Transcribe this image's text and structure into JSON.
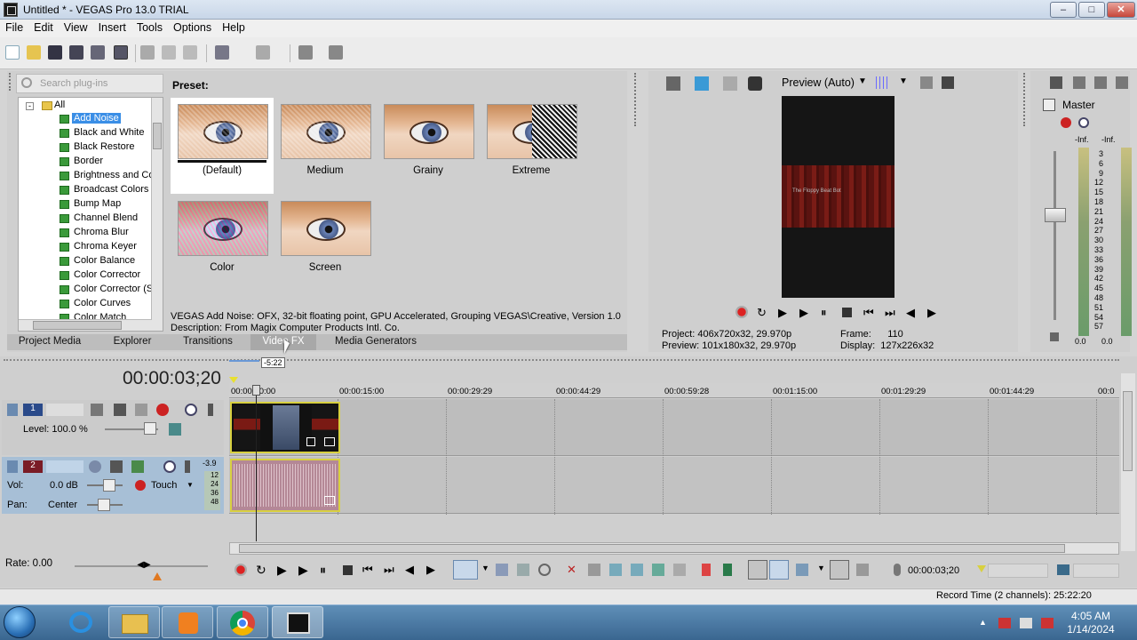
{
  "window": {
    "title": "Untitled * - VEGAS Pro 13.0 TRIAL",
    "min": "–",
    "max": "□",
    "close": "✕"
  },
  "menu": [
    "File",
    "Edit",
    "View",
    "Insert",
    "Tools",
    "Options",
    "Help"
  ],
  "plugins": {
    "search_placeholder": "Search plug-ins",
    "root": "All",
    "items": [
      "Add Noise",
      "Black and White",
      "Black Restore",
      "Border",
      "Brightness and Co",
      "Broadcast Colors",
      "Bump Map",
      "Channel Blend",
      "Chroma Blur",
      "Chroma Keyer",
      "Color Balance",
      "Color Corrector",
      "Color Corrector (S",
      "Color Curves",
      "Color Match"
    ],
    "selected": "Add Noise"
  },
  "presets": {
    "label": "Preset:",
    "items": [
      "(Default)",
      "Medium",
      "Grainy",
      "Extreme",
      "Color",
      "Screen"
    ],
    "description_line1": "VEGAS Add Noise: OFX, 32-bit floating point, GPU Accelerated, Grouping VEGAS\\Creative, Version 1.0",
    "description_line2": "Description: From Magix Computer Products Intl. Co."
  },
  "tabs": [
    "Project Media",
    "Explorer",
    "Transitions",
    "Video FX",
    "Media Generators"
  ],
  "active_tab": "Video FX",
  "preview": {
    "mode": "Preview (Auto)",
    "video_text": "The Floppy Beat Bot",
    "project_label": "Project:",
    "project_value": "406x720x32, 29.970p",
    "preview_label": "Preview:",
    "preview_value": "101x180x32, 29.970p",
    "frame_label": "Frame:",
    "frame_value": "110",
    "display_label": "Display:",
    "display_value": "127x226x32"
  },
  "master": {
    "label": "Master",
    "inf_left": "-Inf.",
    "inf_right": "-Inf.",
    "ticks": [
      "3",
      "6",
      "9",
      "12",
      "15",
      "18",
      "21",
      "24",
      "27",
      "30",
      "33",
      "36",
      "39",
      "42",
      "45",
      "48",
      "51",
      "54",
      "57"
    ],
    "bottom_left": "0.0",
    "bottom_right": "0.0"
  },
  "timeline": {
    "time_code": "00:00:03;20",
    "loop_marker": "-5:22",
    "ruler": [
      "00:00:00:00",
      "00:00:15:00",
      "00:00:29:29",
      "00:00:44:29",
      "00:00:59:28",
      "00:01:15:00",
      "00:01:29:29",
      "00:01:44:29",
      "00:0"
    ],
    "track1": {
      "number": "1",
      "level_label": "Level: 100.0 %"
    },
    "track2": {
      "number": "2",
      "vol_label": "Vol:",
      "vol_value": "0.0 dB",
      "pan_label": "Pan:",
      "pan_value": "Center",
      "automation": "Touch",
      "meter_top": "-3.9",
      "meter_ticks": [
        "12",
        "24",
        "36",
        "48"
      ]
    }
  },
  "transport": {
    "rate": "Rate: 0.00",
    "time": "00:00:03;20"
  },
  "status": {
    "record_time": "Record Time (2 channels): 25:22:20"
  },
  "taskbar": {
    "time": "4:05 AM",
    "date": "1/14/2024"
  },
  "colors": {
    "selection": "#3a8ee6",
    "clip_border": "#d8d040",
    "audio_track": "#a7bfd6"
  }
}
